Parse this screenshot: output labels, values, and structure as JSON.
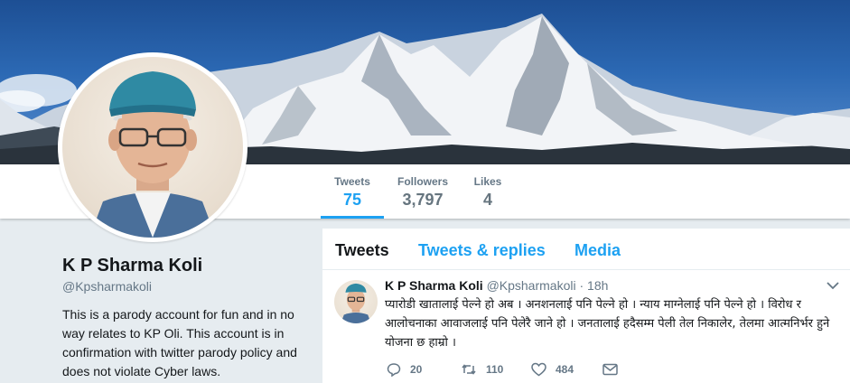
{
  "profile": {
    "name": "K P Sharma Koli",
    "handle": "@Kpsharmakoli",
    "bio": "This is a parody account for fun and in no way relates to KP Oli. This account is in confirmation with twitter parody policy and does not violate Cyber laws."
  },
  "stats": [
    {
      "label": "Tweets",
      "value": "75"
    },
    {
      "label": "Followers",
      "value": "3,797"
    },
    {
      "label": "Likes",
      "value": "4"
    }
  ],
  "tabs": [
    {
      "label": "Tweets"
    },
    {
      "label": "Tweets & replies"
    },
    {
      "label": "Media"
    }
  ],
  "tweet": {
    "name": "K P Sharma Koli",
    "handle": "@Kpsharmakoli",
    "separator": "·",
    "time": "18h",
    "text": "प्यारोडी खातालाई पेल्ने हो अब । अनशनलाई पनि पेल्ने हो । न्याय माग्नेलाई पनि पेल्ने हो । विरोध र आलोचनाका आवाजलाई पनि पेलेरै जाने हो । जनतालाई हदैसम्म पेली तेल निकालेर, तेलमा आत्मनिर्भर हुने योजना छ हाम्रो ।",
    "reply_count": "20",
    "retweet_count": "110",
    "like_count": "484"
  },
  "colors": {
    "accent": "#1da1f2",
    "page_bg": "#e6ecf0",
    "muted": "#657786"
  },
  "icons": [
    "reply-icon",
    "retweet-icon",
    "like-icon",
    "direct-message-icon",
    "chevron-down-icon"
  ]
}
